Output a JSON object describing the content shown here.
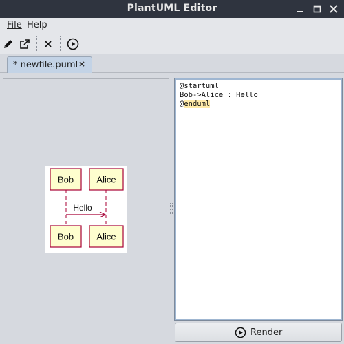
{
  "window": {
    "title": "PlantUML Editor"
  },
  "menu": {
    "file": "File",
    "help": "Help"
  },
  "toolbar": {
    "tools": [
      {
        "name": "edit",
        "icon": "pencil-icon"
      },
      {
        "name": "open-external",
        "icon": "external-link-icon"
      },
      {
        "name": "close",
        "icon": "close-icon"
      },
      {
        "name": "run",
        "icon": "play-circle-icon"
      }
    ]
  },
  "tabs": [
    {
      "label": "* newfile.puml",
      "close": "×"
    }
  ],
  "diagram": {
    "participant_1": "Bob",
    "participant_2": "Alice",
    "message": "Hello"
  },
  "editor": {
    "lines": [
      "@startuml",
      "Bob->Alice : Hello",
      "@enduml"
    ]
  },
  "render_button": {
    "label": "Render"
  },
  "colors": {
    "titlebar": "#2f343f",
    "participant_fill": "#fefece",
    "participant_border": "#a80036",
    "arrow": "#a80036",
    "highlight": "#ffeaa8",
    "editor_border": "#9fb6d1"
  }
}
